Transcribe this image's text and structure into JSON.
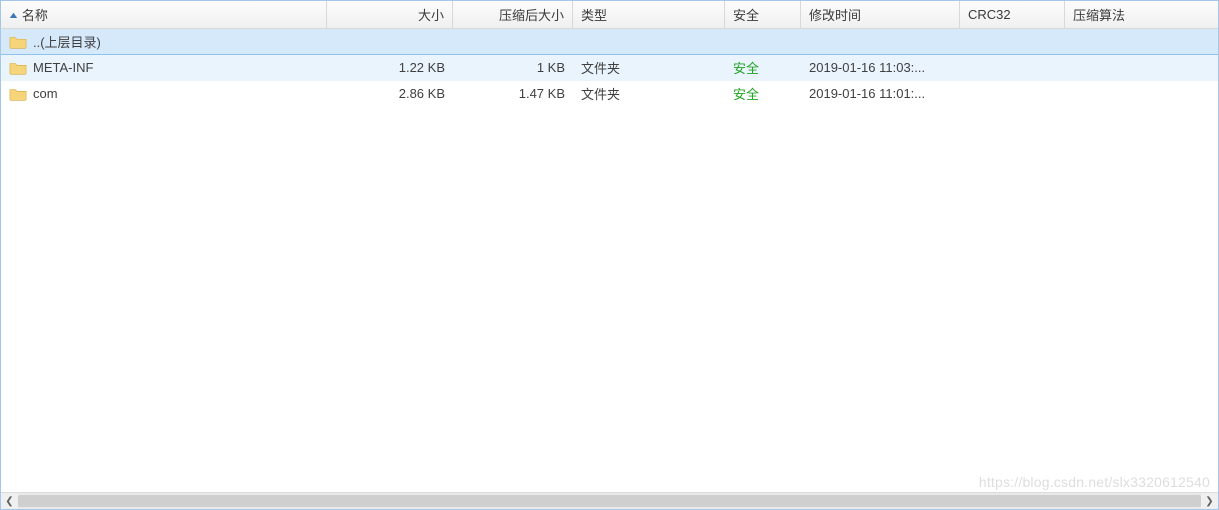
{
  "columns": {
    "name": {
      "label": "名称",
      "sorted": true
    },
    "size": {
      "label": "大小"
    },
    "csize": {
      "label": "压缩后大小"
    },
    "type": {
      "label": "类型"
    },
    "safe": {
      "label": "安全"
    },
    "mtime": {
      "label": "修改时间"
    },
    "crc": {
      "label": "CRC32"
    },
    "algo": {
      "label": "压缩算法"
    }
  },
  "sort_indicator": "▲",
  "rows": [
    {
      "kind": "parent",
      "name": "..(上层目录)",
      "size": "",
      "csize": "",
      "type": "",
      "safe": "",
      "mtime": "",
      "crc": "",
      "algo": ""
    },
    {
      "kind": "selected",
      "name": "META-INF",
      "size": "1.22 KB",
      "csize": "1 KB",
      "type": "文件夹",
      "safe": "安全",
      "mtime": "2019-01-16 11:03:...",
      "crc": "",
      "algo": ""
    },
    {
      "kind": "normal",
      "name": "com",
      "size": "2.86 KB",
      "csize": "1.47 KB",
      "type": "文件夹",
      "safe": "安全",
      "mtime": "2019-01-16 11:01:...",
      "crc": "",
      "algo": ""
    }
  ],
  "watermark": "https://blog.csdn.net/slx3320612540"
}
